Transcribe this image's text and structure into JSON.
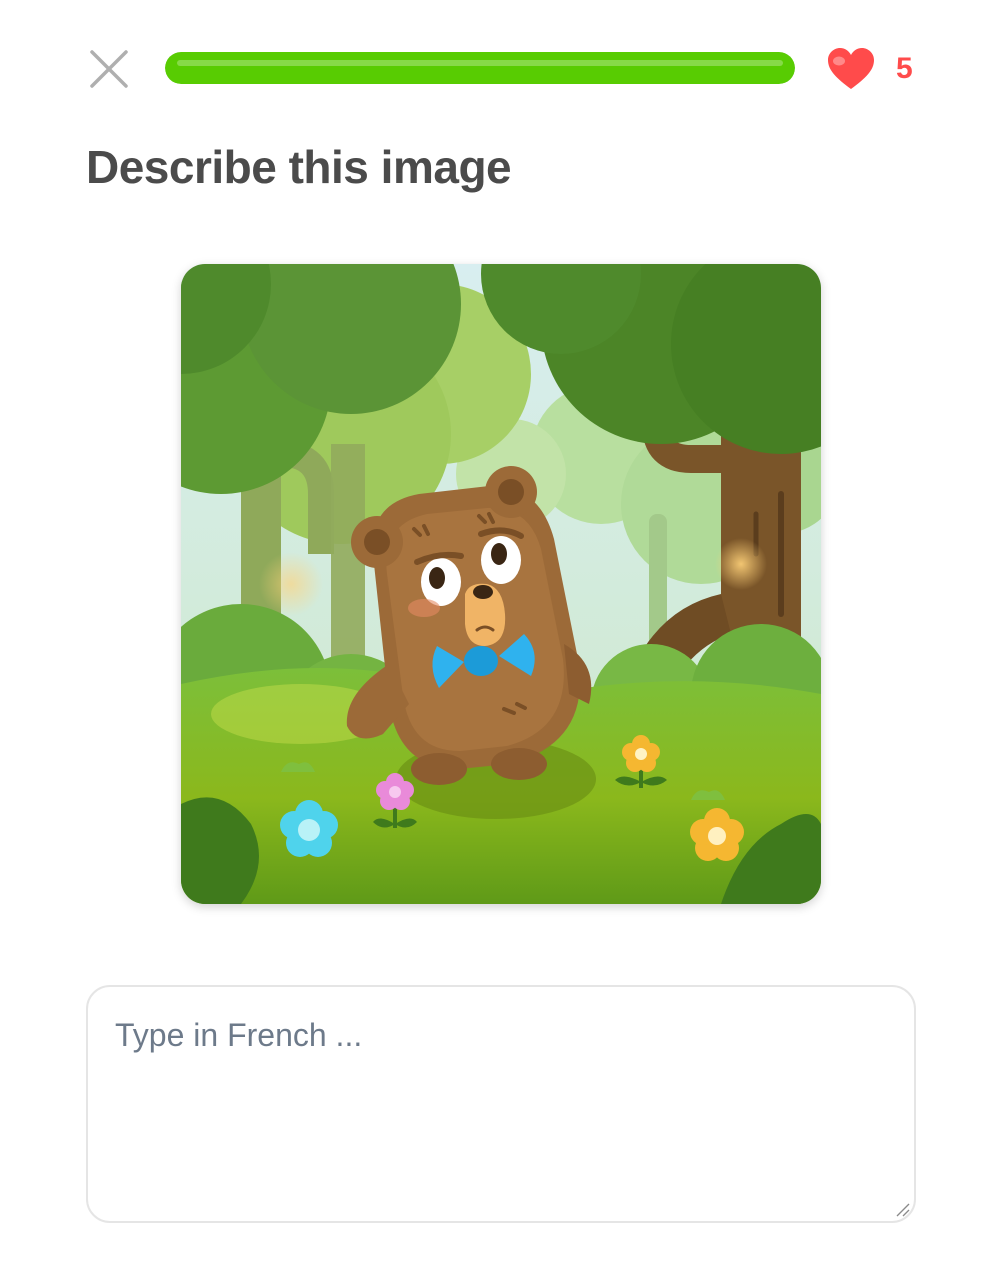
{
  "header": {
    "close_icon": "close-icon",
    "progress": {
      "fraction": 1.0,
      "color": "#58cc02"
    },
    "hearts": {
      "icon": "heart-icon",
      "count": "5",
      "color": "#ff4b4b"
    }
  },
  "challenge": {
    "title": "Describe this image",
    "image_icon": "bear-with-bowtie-in-forest"
  },
  "answer": {
    "value": "",
    "placeholder": "Type in French ..."
  }
}
